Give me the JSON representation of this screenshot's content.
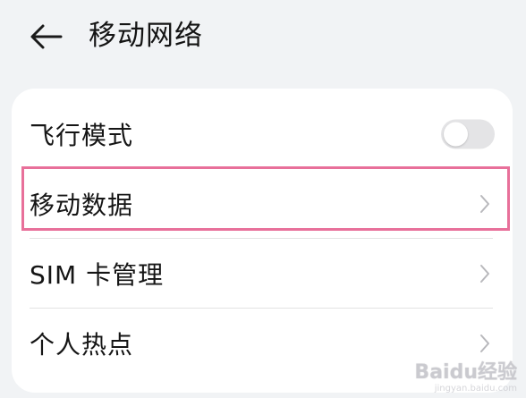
{
  "header": {
    "back_icon": "arrow-left-icon",
    "title": "移动网络"
  },
  "settings": {
    "rows": [
      {
        "label": "飞行模式",
        "control": "toggle",
        "toggle_on": false
      },
      {
        "label": "移动数据",
        "control": "chevron",
        "highlighted": true
      },
      {
        "label": "SIM 卡管理",
        "control": "chevron"
      },
      {
        "label": "个人热点",
        "control": "chevron"
      }
    ]
  },
  "watermark": {
    "brand": "Baidu经验",
    "site": "jingyan.baidu.com"
  },
  "colors": {
    "background": "#f1f3f5",
    "card": "#ffffff",
    "highlight": "#e8709a",
    "toggle_off": "#e4e4e6"
  }
}
